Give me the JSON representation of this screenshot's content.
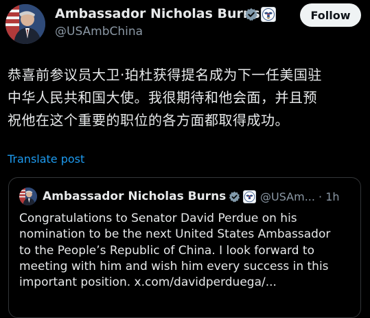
{
  "post": {
    "author_name": "Ambassador Nicholas Burns",
    "handle": "@USAmbChina",
    "follow_label": "Follow",
    "text_lines": [
      "恭喜前参议员大卫·珀杜获得提名成为下一任美国驻",
      "中华人民共和国大使。我很期待和他会面，并且预",
      "祝他在这个重要的职位的各方面都取得成功。"
    ],
    "translate_label": "Translate post"
  },
  "quoted_post": {
    "author_name": "Ambassador Nicholas Burns",
    "handle_truncated": "@USAm...",
    "separator": "·",
    "time": "1h",
    "text_lines": [
      "Congratulations to Senator David Perdue on his",
      "nomination to be the next United States Ambassador",
      "to the People’s Republic of China.  I look forward to",
      "meeting with him and wish him every success in this",
      "important position. x.com/davidperduega/..."
    ]
  },
  "colors": {
    "background": "#000000",
    "text_primary": "#e7e9ea",
    "text_secondary": "#8b98a5",
    "link": "#1d9bf0",
    "border": "#333639",
    "follow_bg": "#eff3f4",
    "verified_gray": "#829aab"
  },
  "icons": {
    "avatar": "avatar-photo",
    "verified": "gray-verified-badge-icon",
    "affiliation": "state-department-seal-icon"
  }
}
